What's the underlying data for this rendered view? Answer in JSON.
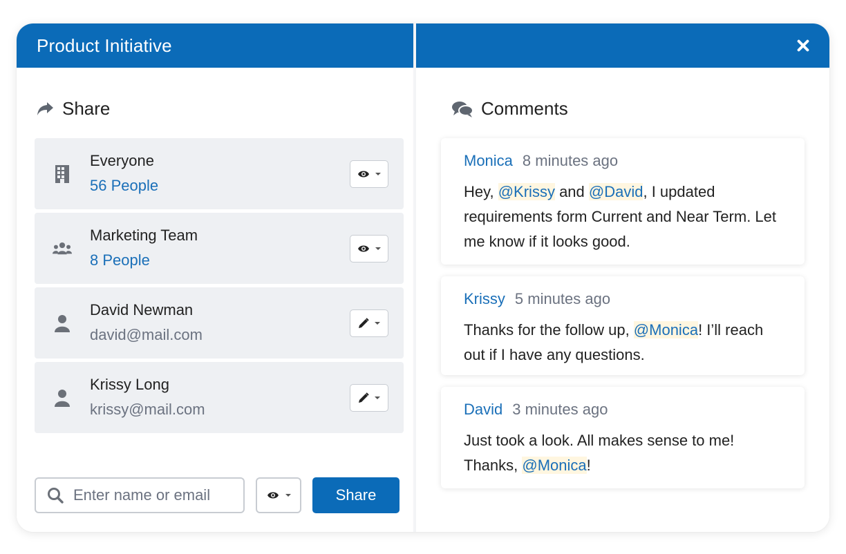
{
  "dialog": {
    "title": "Product Initiative",
    "close_icon": "close-icon"
  },
  "share": {
    "title": "Share",
    "icon": "share-icon",
    "items": [
      {
        "icon": "building-icon",
        "name": "Everyone",
        "sub": "56 People",
        "sub_is_link": true,
        "permission_icon": "eye-icon"
      },
      {
        "icon": "group-icon",
        "name": "Marketing Team",
        "sub": "8 People",
        "sub_is_link": true,
        "permission_icon": "eye-icon"
      },
      {
        "icon": "user-icon",
        "name": "David Newman",
        "sub": "david@mail.com",
        "sub_is_link": false,
        "permission_icon": "pencil-icon"
      },
      {
        "icon": "user-icon",
        "name": "Krissy Long",
        "sub": "krissy@mail.com",
        "sub_is_link": false,
        "permission_icon": "pencil-icon"
      }
    ],
    "search": {
      "placeholder": "Enter name or email",
      "value": ""
    },
    "permission_select_icon": "eye-icon",
    "button_label": "Share"
  },
  "comments": {
    "title": "Comments",
    "icon": "comments-icon",
    "items": [
      {
        "author": "Monica",
        "time": "8 minutes ago",
        "parts": [
          {
            "text": "Hey, "
          },
          {
            "text": "@Krissy",
            "mention": true
          },
          {
            "text": " and "
          },
          {
            "text": "@David",
            "mention": true
          },
          {
            "text": ", I updated requirements form Current and Near Term. Let me know if it looks good."
          }
        ]
      },
      {
        "author": "Krissy",
        "time": "5 minutes ago",
        "parts": [
          {
            "text": "Thanks for the follow up, "
          },
          {
            "text": "@Monica",
            "mention": true
          },
          {
            "text": "! I’ll reach out if I have any questions."
          }
        ]
      },
      {
        "author": "David",
        "time": "3 minutes ago",
        "parts": [
          {
            "text": "Just took a look. All makes sense to me!",
            "break_after": true
          },
          {
            "text": "Thanks, "
          },
          {
            "text": "@Monica",
            "mention": true
          },
          {
            "text": "!"
          }
        ]
      }
    ]
  },
  "colors": {
    "accent": "#0b6bb8",
    "link": "#1a6fb8",
    "mention_bg": "#fff6e0",
    "row_bg": "#eef0f3"
  }
}
